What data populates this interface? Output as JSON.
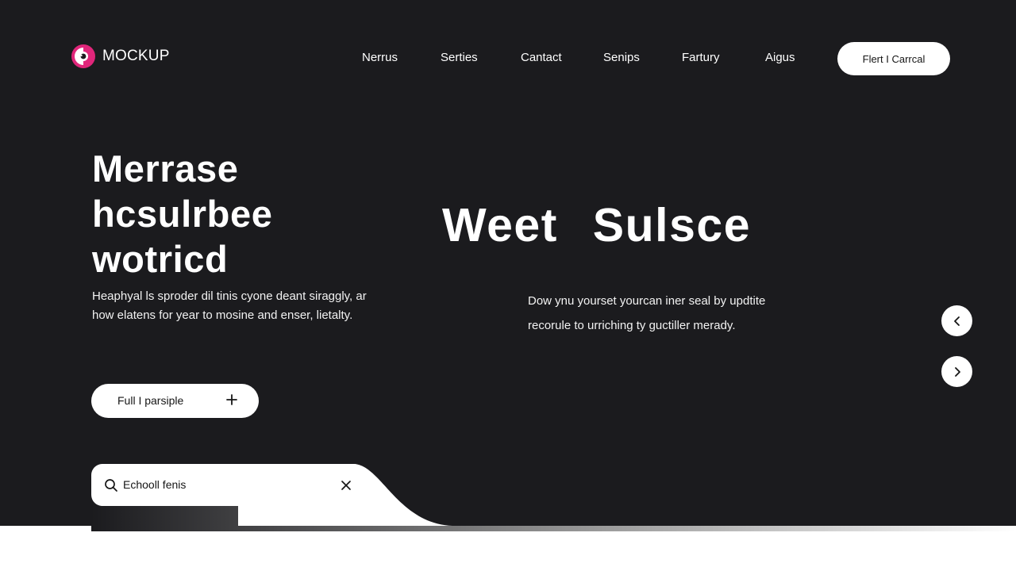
{
  "header": {
    "logo_text": "MOCKUP",
    "logo_icon": "mockup-logo-icon",
    "nav": [
      {
        "label": "Nerrus"
      },
      {
        "label": "Serties"
      },
      {
        "label": "Cantact"
      },
      {
        "label": "Senips"
      },
      {
        "label": "Fartury"
      },
      {
        "label": "Aigus"
      }
    ],
    "cta_label": "Flert I Carrcal"
  },
  "hero": {
    "title_lines": [
      "Merrase",
      "hcsulrbee",
      "wotricd"
    ],
    "desc_lines": [
      "Heaphyal ls sproder dil tinis cyone deant siraggly, ar",
      "how elatens for year to mosine and enser, lietalty."
    ],
    "primary_button": {
      "label": "Full I parsiple",
      "icon": "plus-icon"
    }
  },
  "feature": {
    "title": "Weet Sulsce",
    "desc_lines": [
      "Dow ynu yourset yourcan iner seal by updtite",
      "recorule to urriching ty guctiller merady."
    ]
  },
  "carousel": {
    "prev_icon": "chevron-left-icon",
    "next_icon": "chevron-right-icon"
  },
  "search": {
    "value": "Echooll fenis",
    "placeholder": "",
    "icon": "search-icon",
    "clear_icon": "close-icon"
  },
  "colors": {
    "background": "#1b1b1e",
    "surface": "#ffffff",
    "accent": "#e0267a",
    "text_dark": "#151515"
  }
}
